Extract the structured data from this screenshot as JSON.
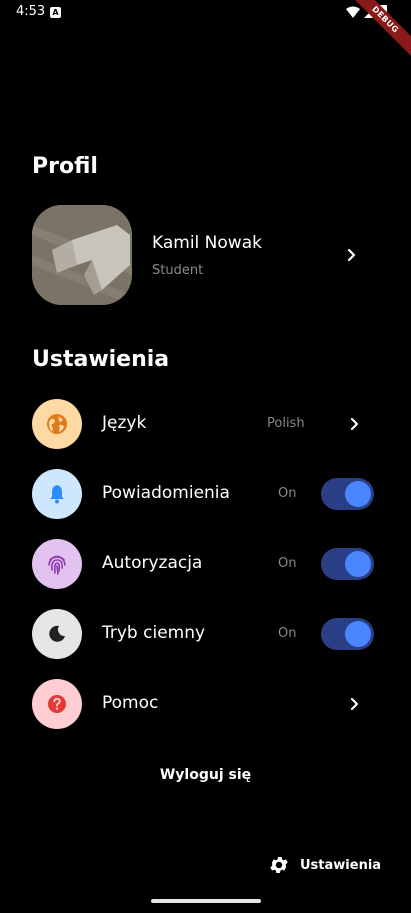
{
  "status_bar": {
    "time": "4:53",
    "a_badge": "A",
    "debug_label": "DEBUG"
  },
  "profile": {
    "section_title": "Profil",
    "name": "Kamil Nowak",
    "role": "Student"
  },
  "settings": {
    "section_title": "Ustawienia",
    "items": [
      {
        "label": "Język",
        "value": "Polish",
        "icon": "globe-icon",
        "icon_bg": "#ffd9a3",
        "icon_color": "#e07a1a",
        "control": "chevron"
      },
      {
        "label": "Powiadomienia",
        "value": "On",
        "icon": "bell-icon",
        "icon_bg": "#cfe6ff",
        "icon_color": "#2f8cff",
        "control": "toggle",
        "enabled": true
      },
      {
        "label": "Autoryzacja",
        "value": "On",
        "icon": "fingerprint-icon",
        "icon_bg": "#e2c3f0",
        "icon_color": "#8a3bb0",
        "control": "toggle",
        "enabled": true
      },
      {
        "label": "Tryb ciemny",
        "value": "On",
        "icon": "moon-icon",
        "icon_bg": "#e5e5e5",
        "icon_color": "#222222",
        "control": "toggle",
        "enabled": true
      },
      {
        "label": "Pomoc",
        "value": "",
        "icon": "help-icon",
        "icon_bg": "#ffcdd2",
        "icon_color": "#e53935",
        "control": "chevron"
      }
    ]
  },
  "logout_label": "Wyloguj się",
  "bottom_action": {
    "label": "Ustawienia",
    "icon": "gear-icon"
  },
  "colors": {
    "toggle_track": "#2b3f86",
    "toggle_knob": "#4a86ff",
    "background": "#000000"
  }
}
